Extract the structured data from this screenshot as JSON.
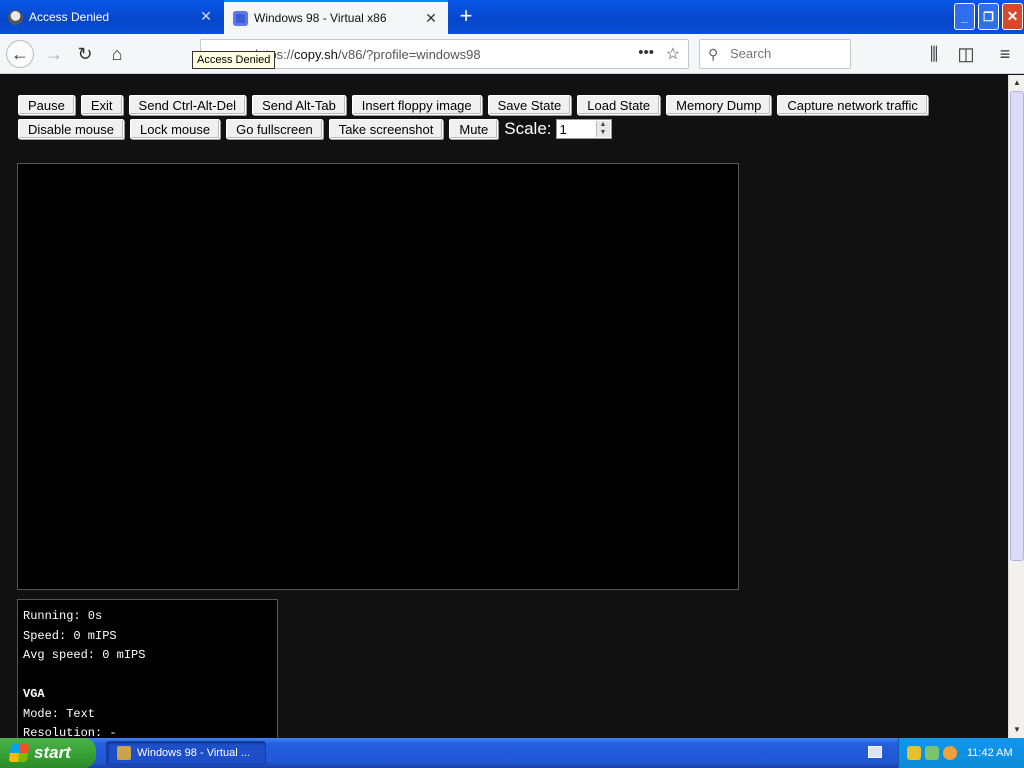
{
  "tabs": [
    {
      "label": "Access Denied",
      "active": false
    },
    {
      "label": "Windows 98 - Virtual x86",
      "active": true
    }
  ],
  "url": {
    "prefix": "https://",
    "host": "copy.sh",
    "path": "/v86/?profile=windows98"
  },
  "search": {
    "placeholder": "Search"
  },
  "tooltip": "Access Denied",
  "toolbar": {
    "row1": [
      "Pause",
      "Exit",
      "Send Ctrl-Alt-Del",
      "Send Alt-Tab",
      "Insert floppy image",
      "Save State",
      "Load State",
      "Memory Dump",
      "Capture network traffic"
    ],
    "row2": [
      "Disable mouse",
      "Lock mouse",
      "Go fullscreen",
      "Take screenshot",
      "Mute"
    ],
    "scale_label": "Scale:",
    "scale_value": "1"
  },
  "stats": {
    "running": "Running: 0s",
    "speed": "Speed: 0 mIPS",
    "avg_speed": "Avg speed: 0 mIPS",
    "vga_heading": "VGA",
    "mode": "Mode: Text",
    "resolution": "Resolution: -"
  },
  "taskbar": {
    "start_label": "start",
    "task_label": "Windows 98 - Virtual ...",
    "clock": "11:42 AM"
  },
  "colors": {
    "page_bg": "#111111",
    "titlebar_blue": "#0646c9",
    "taskbar_blue": "#245edb",
    "start_green": "#38a335",
    "tray_blue": "#0d8bd8"
  }
}
